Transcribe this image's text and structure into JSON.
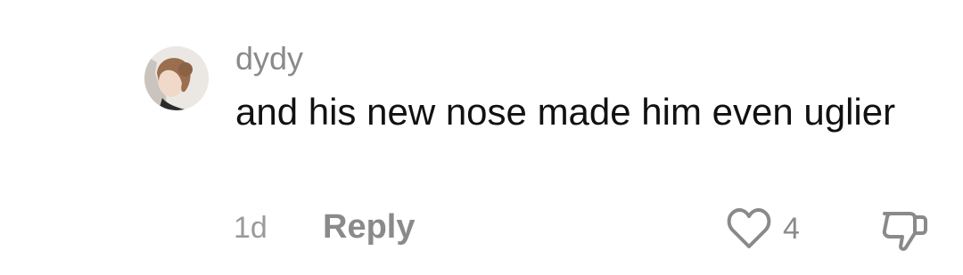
{
  "comment": {
    "username": "dydy",
    "text": "and his new nose made him even uglier",
    "timestamp": "1d",
    "reply_label": "Reply",
    "like_count": "4",
    "like_icon": "heart-icon",
    "dislike_icon": "thumbs-down-icon"
  },
  "colors": {
    "text_primary": "#111111",
    "text_secondary": "#8a8a8a",
    "background": "#ffffff"
  }
}
